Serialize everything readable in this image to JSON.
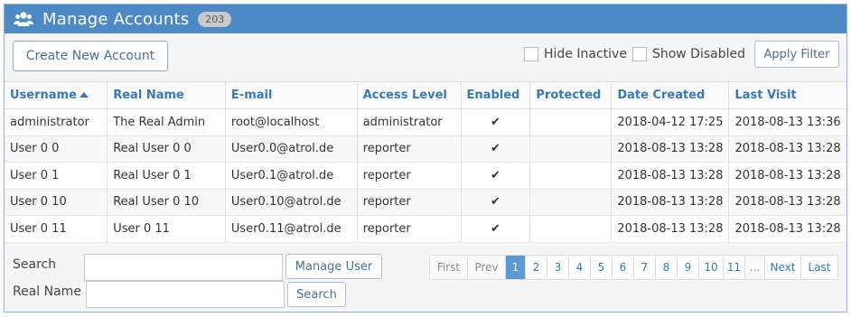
{
  "header": {
    "title": "Manage Accounts",
    "count": "203"
  },
  "toolbar": {
    "create_label": "Create New Account",
    "hide_inactive": "Hide Inactive",
    "show_disabled": "Show Disabled",
    "apply_filter": "Apply Filter"
  },
  "table": {
    "columns": [
      "Username",
      "Real Name",
      "E-mail",
      "Access Level",
      "Enabled",
      "Protected",
      "Date Created",
      "Last Visit"
    ],
    "rows": [
      {
        "username": "administrator",
        "realname": "The Real Admin",
        "email": "root@localhost",
        "access": "administrator",
        "enabled": "✔",
        "protected": "",
        "created": "2018-04-12 17:25",
        "visit": "2018-08-13 13:36"
      },
      {
        "username": "User 0 0",
        "realname": "Real User 0 0",
        "email": "User0.0@atrol.de",
        "access": "reporter",
        "enabled": "✔",
        "protected": "",
        "created": "2018-08-13 13:28",
        "visit": "2018-08-13 13:28"
      },
      {
        "username": "User 0 1",
        "realname": "Real User 0 1",
        "email": "User0.1@atrol.de",
        "access": "reporter",
        "enabled": "✔",
        "protected": "",
        "created": "2018-08-13 13:28",
        "visit": "2018-08-13 13:28"
      },
      {
        "username": "User 0 10",
        "realname": "Real User 0 10",
        "email": "User0.10@atrol.de",
        "access": "reporter",
        "enabled": "✔",
        "protected": "",
        "created": "2018-08-13 13:28",
        "visit": "2018-08-13 13:28"
      },
      {
        "username": "User 0 11",
        "realname": "User 0 11",
        "email": "User0.11@atrol.de",
        "access": "reporter",
        "enabled": "✔",
        "protected": "",
        "created": "2018-08-13 13:28",
        "visit": "2018-08-13 13:28"
      }
    ]
  },
  "search": {
    "search_label": "Search",
    "manage_user": "Manage User",
    "realname_label": "Real Name",
    "search_button": "Search"
  },
  "pagination": [
    "First",
    "Prev",
    "1",
    "2",
    "3",
    "4",
    "5",
    "6",
    "7",
    "8",
    "9",
    "10",
    "11",
    "...",
    "Next",
    "Last"
  ],
  "pagination_current": "1"
}
